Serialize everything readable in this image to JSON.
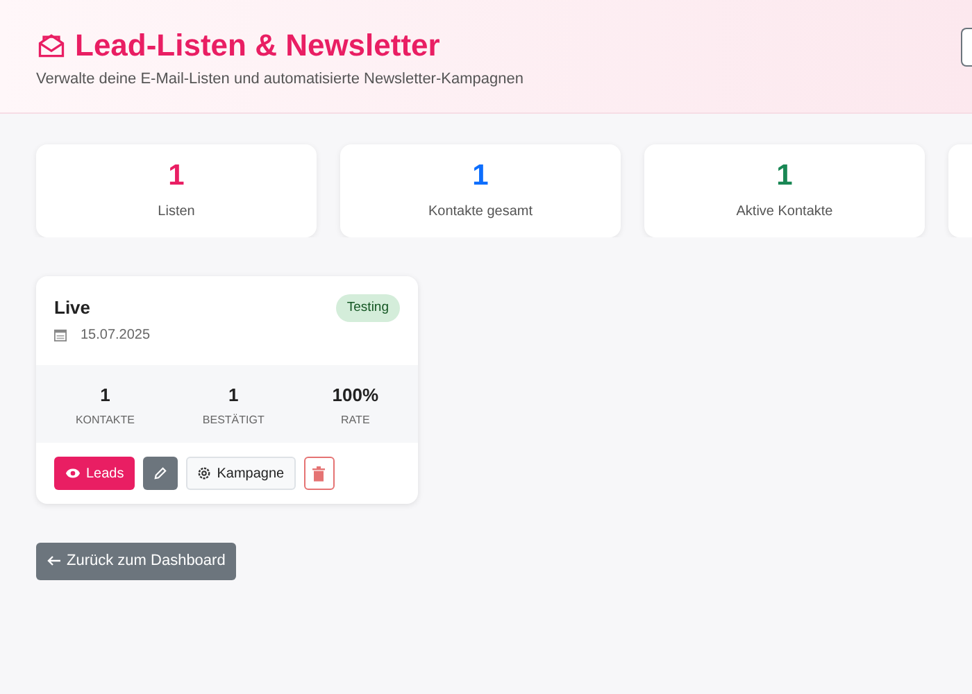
{
  "header": {
    "title": "Lead-Listen & Newsletter",
    "subtitle": "Verwalte deine E-Mail-Listen und automatisierte Newsletter-Kampagnen"
  },
  "stats": [
    {
      "value": "1",
      "label": "Listen",
      "color": "#e91e63"
    },
    {
      "value": "1",
      "label": "Kontakte gesamt",
      "color": "#0d6efd"
    },
    {
      "value": "1",
      "label": "Aktive Kontakte",
      "color": "#198754"
    }
  ],
  "lists": [
    {
      "name": "Live",
      "date": "15.07.2025",
      "badge": "Testing",
      "metrics": [
        {
          "value": "1",
          "label": "KONTAKTE"
        },
        {
          "value": "1",
          "label": "BESTÄTIGT"
        },
        {
          "value": "100%",
          "label": "RATE"
        }
      ],
      "actions": [
        {
          "kind": "leads",
          "label": "Leads"
        },
        {
          "kind": "edit"
        },
        {
          "kind": "campaign",
          "label": "Kampagne"
        },
        {
          "kind": "delete"
        }
      ]
    }
  ],
  "back_button": {
    "label": "Zurück zum Dashboard"
  }
}
